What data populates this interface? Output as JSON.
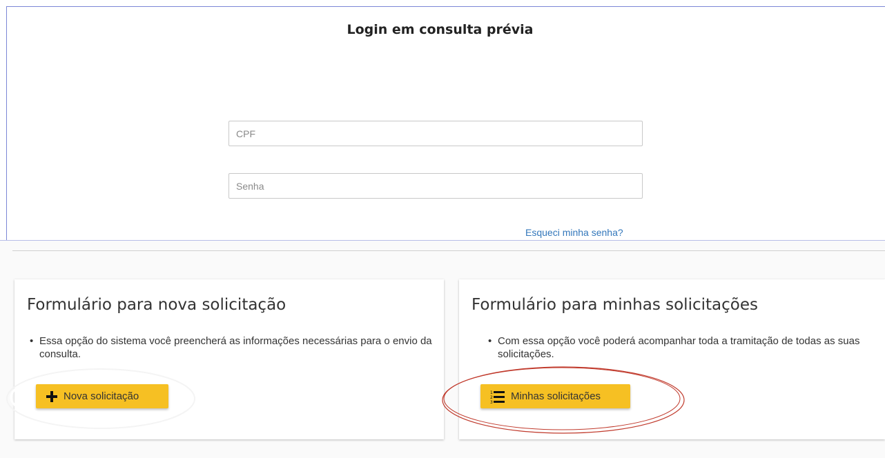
{
  "login": {
    "title": "Login em consulta prévia",
    "cpf_placeholder": "CPF",
    "senha_placeholder": "Senha",
    "forgot_link": "Esqueci minha senha?"
  },
  "cards": {
    "nova": {
      "title": "Formulário para nova solicitação",
      "text": "Essa opção do sistema você preencherá as informações necessárias para o envio da consulta.",
      "button_label": "Nova solicitação",
      "button_icon": "plus-icon"
    },
    "minhas": {
      "title": "Formulário para minhas solicitações",
      "text": "Com essa opção você poderá acompanhar toda a tramitação de todas as suas solicitações.",
      "button_label": "Minhas solicitações",
      "button_icon": "numbered-list-icon"
    }
  },
  "colors": {
    "button_yellow": "#f6c023",
    "link_blue": "#3377bb",
    "annotation_red": "#c0392b"
  }
}
